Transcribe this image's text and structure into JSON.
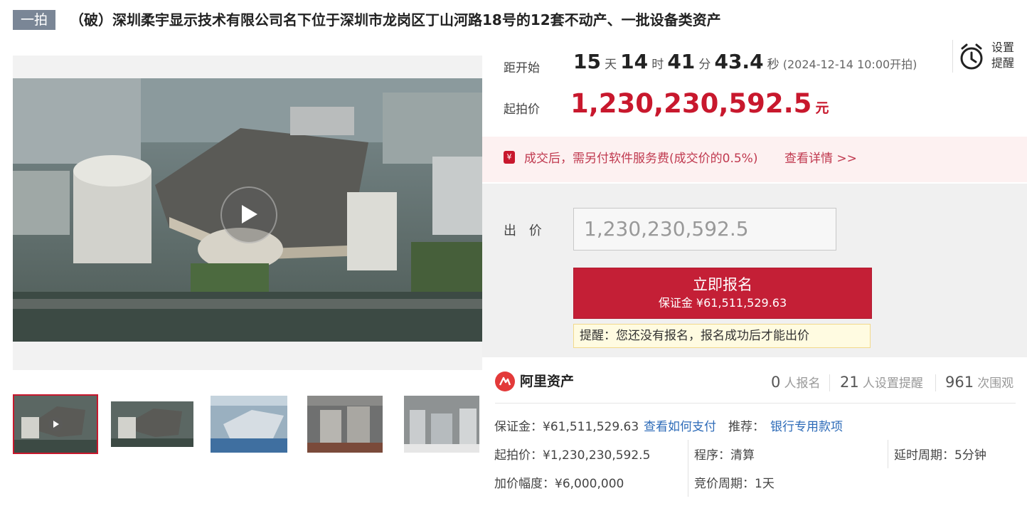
{
  "header": {
    "round_badge": "一拍",
    "title": "（破）深圳柔宇显示技术有限公司名下位于深圳市龙岗区丁山河路18号的12套不动产、一批设备类资产"
  },
  "countdown": {
    "label": "距开始",
    "days": "15",
    "days_unit": "天",
    "hours": "14",
    "hours_unit": "时",
    "minutes": "41",
    "minutes_unit": "分",
    "seconds": "43.4",
    "seconds_unit": "秒",
    "start_time": "(2024-12-14 10:00开拍)"
  },
  "reminder": {
    "label_line1": "设置",
    "label_line2": "提醒",
    "icon": "alarm-clock-icon"
  },
  "start_price": {
    "label": "起拍价",
    "value": "1,230,230,592.5",
    "unit": "元"
  },
  "fee_notice": {
    "text": "成交后，需另付软件服务费(成交价的0.5%)",
    "link": "查看详情 >>"
  },
  "bid": {
    "label": "出 价",
    "input_value": "1,230,230,592.5",
    "signup_label": "立即报名",
    "deposit_label": "保证金 ¥61,511,529.63",
    "tip": "提醒：您还没有报名，报名成功后才能出价"
  },
  "platform": {
    "name": "阿里资产"
  },
  "stats": {
    "signups": "0",
    "signups_label": "人报名",
    "reminders": "21",
    "reminders_label": "人设置提醒",
    "views": "961",
    "views_label": "次围观"
  },
  "details": {
    "deposit": "保证金：¥61,511,529.63",
    "how_to_pay": "查看如何支付",
    "recommend_label": "推荐：",
    "recommend_link": "银行专用款项",
    "start_price": "起拍价：¥1,230,230,592.5",
    "procedure": "程序：清算",
    "delay_period": "延时周期：5分钟",
    "increment": "加价幅度：¥6,000,000",
    "bid_period": "竞价周期：1天"
  },
  "colors": {
    "accent": "#c8182d",
    "link": "#2d6bb8",
    "badge": "#7a8696"
  }
}
